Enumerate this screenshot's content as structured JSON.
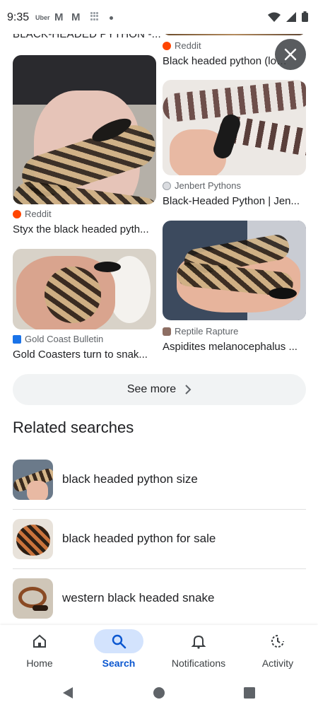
{
  "status_bar": {
    "time": "9:35",
    "uber": "Uber",
    "mail1": "M",
    "mail2": "M"
  },
  "results": {
    "top_cut_title": "BLACK-HEADED PYTHON -...",
    "cards": [
      {
        "source": "Reddit",
        "title": "Black headed python (local...",
        "icon_color": "#ff4500"
      },
      {
        "source": "Jenbert Pythons",
        "title": "Black-Headed Python | Jen...",
        "icon_color": "#9aa0a6"
      },
      {
        "source": "Reddit",
        "title": "Styx the black headed pyth...",
        "icon_color": "#ff4500"
      },
      {
        "source": "Gold Coast Bulletin",
        "title": "Gold Coasters turn to snak...",
        "icon_color": "#1a73e8"
      },
      {
        "source": "Reptile Rapture",
        "title": "Aspidites melanocephalus ...",
        "icon_color": "#8d6e63"
      }
    ],
    "see_more": "See more"
  },
  "related": {
    "title": "Related searches",
    "items": [
      {
        "label": "black headed python size"
      },
      {
        "label": "black headed python for sale"
      },
      {
        "label": "western black headed snake"
      }
    ]
  },
  "bottom_nav": {
    "items": [
      {
        "label": "Home",
        "icon": "home-icon"
      },
      {
        "label": "Search",
        "icon": "search-icon",
        "active": true
      },
      {
        "label": "Notifications",
        "icon": "bell-icon"
      },
      {
        "label": "Activity",
        "icon": "activity-icon"
      }
    ]
  },
  "colors": {
    "accent": "#0b57d0",
    "active_pill": "#d3e3fd",
    "chip_bg": "#f1f3f4"
  }
}
